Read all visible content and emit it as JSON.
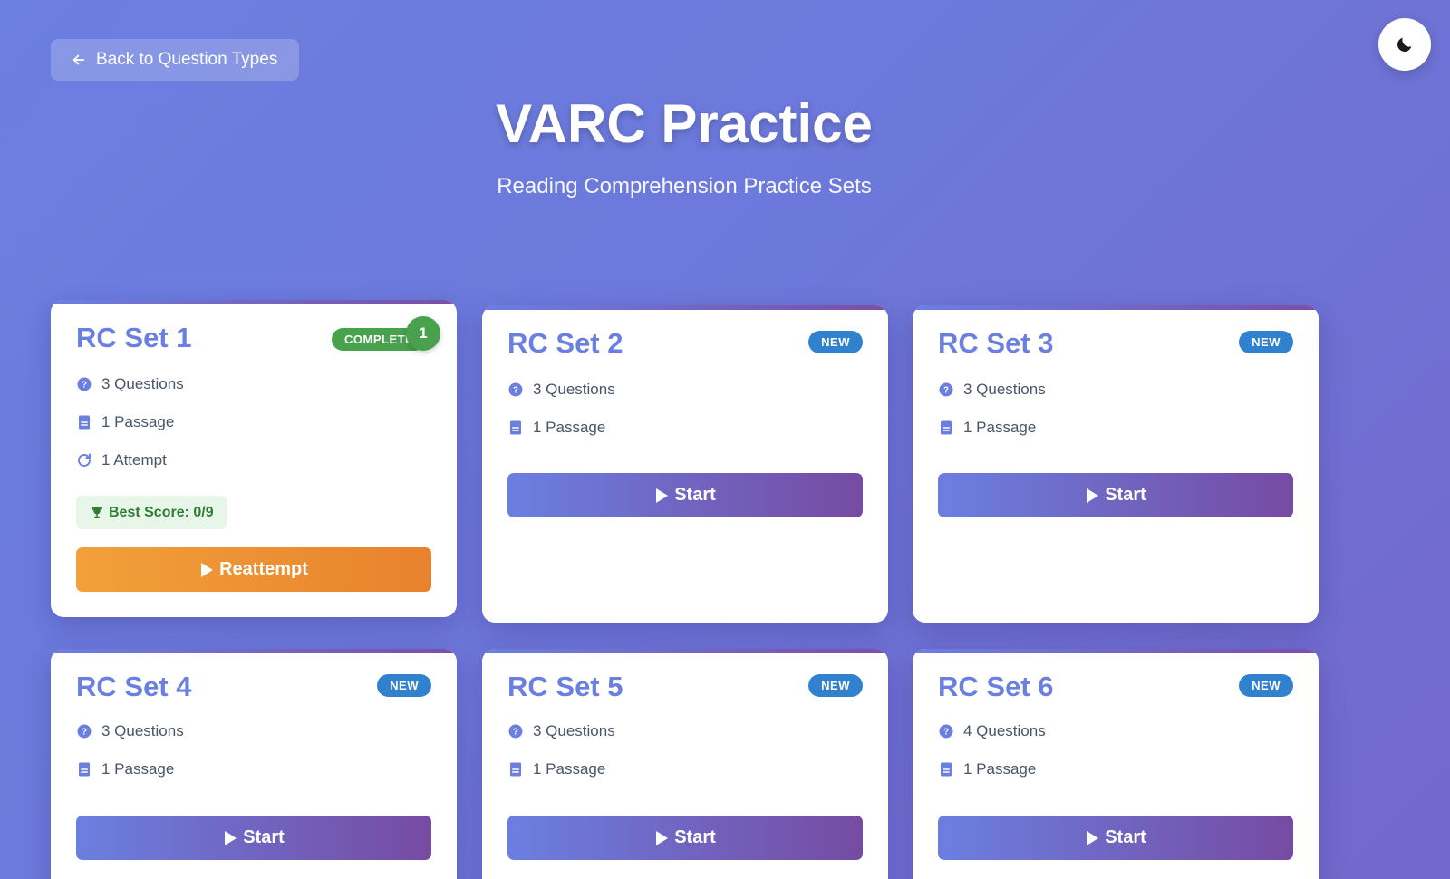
{
  "nav": {
    "back_label": "Back to Question Types"
  },
  "theme_toggle": {
    "icon": "moon-icon"
  },
  "header": {
    "title": "VARC Practice",
    "subtitle": "Reading Comprehension Practice Sets"
  },
  "colors": {
    "accent": "#6b7fe0",
    "accent_end": "#764ba2",
    "new_badge": "#3182ce",
    "completed_badge": "#48a14d",
    "reattempt": "#f2a03a"
  },
  "cards": [
    {
      "title": "RC Set 1",
      "status": "COMPLETED",
      "attempt_badge": "1",
      "questions": "3 Questions",
      "passages": "1 Passage",
      "attempts": "1 Attempt",
      "best_score": "Best Score: 0/9",
      "action": "Reattempt"
    },
    {
      "title": "RC Set 2",
      "status": "NEW",
      "questions": "3 Questions",
      "passages": "1 Passage",
      "action": "Start"
    },
    {
      "title": "RC Set 3",
      "status": "NEW",
      "questions": "3 Questions",
      "passages": "1 Passage",
      "action": "Start"
    },
    {
      "title": "RC Set 4",
      "status": "NEW",
      "questions": "3 Questions",
      "passages": "1 Passage",
      "action": "Start"
    },
    {
      "title": "RC Set 5",
      "status": "NEW",
      "questions": "3 Questions",
      "passages": "1 Passage",
      "action": "Start"
    },
    {
      "title": "RC Set 6",
      "status": "NEW",
      "questions": "4 Questions",
      "passages": "1 Passage",
      "action": "Start"
    }
  ]
}
